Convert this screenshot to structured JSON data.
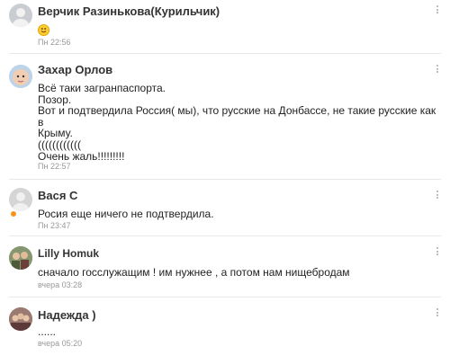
{
  "comments": [
    {
      "author": "Верчик Разинькова(Курильчик)",
      "text": "",
      "emoji": "smiley-face-icon",
      "time": "Пн 22:56"
    },
    {
      "author": "Захар Орлов",
      "text": "Всё таки загранпаспорта.\nПозор.\nВот и подтвердила Россия( мы), что русские на Донбассе, не такие русские как в\nКрыму.\n((((((((((((\nОчень жаль!!!!!!!!!",
      "time": "Пн 22:57"
    },
    {
      "author": "Вася С",
      "text": "Росия еще ничего не подтвердила.",
      "time": "Пн 23:47"
    },
    {
      "author": "Lilly Homuk",
      "text": "сначало госслужащим ! им нужнее , а потом нам нищебродам",
      "time": "вчера 03:28"
    },
    {
      "author": "Надежда )",
      "text": "......",
      "time": "вчера 05:20"
    }
  ],
  "colors": {
    "online": "#f7931e",
    "time": "#999999",
    "divider": "#e8e8e8"
  }
}
